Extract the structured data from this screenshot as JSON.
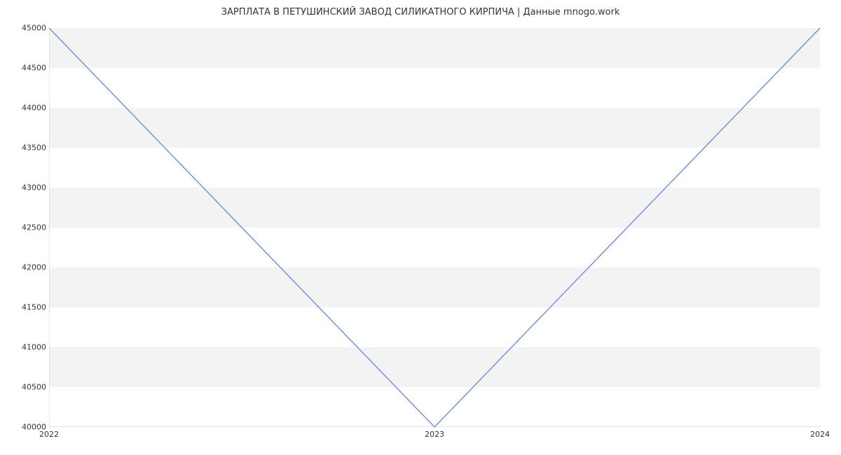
{
  "chart_data": {
    "type": "line",
    "title": "ЗАРПЛАТА В  ПЕТУШИНСКИЙ ЗАВОД СИЛИКАТНОГО КИРПИЧА | Данные mnogo.work",
    "x": [
      2022,
      2023,
      2024
    ],
    "x_tick_labels": [
      "2022",
      "2023",
      "2024"
    ],
    "series": [
      {
        "name": "salary",
        "values": [
          45000,
          40000,
          45000
        ]
      }
    ],
    "xlabel": "",
    "ylabel": "",
    "ylim": [
      40000,
      45000
    ],
    "y_ticks": [
      40000,
      40500,
      41000,
      41500,
      42000,
      42500,
      43000,
      43500,
      44000,
      44500,
      45000
    ],
    "xlim": [
      2022,
      2024
    ],
    "grid": true,
    "colors": {
      "line": "#6b8fd6",
      "plot_bg": "#f3f3f3",
      "band": "#ffffff"
    }
  }
}
